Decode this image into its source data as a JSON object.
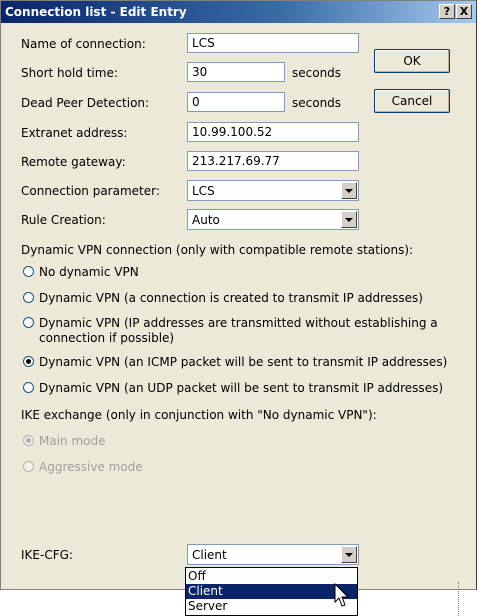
{
  "window": {
    "title": "Connection list - Edit Entry",
    "help_label": "?",
    "close_label": "X"
  },
  "buttons": {
    "ok": "OK",
    "cancel": "Cancel"
  },
  "fields": {
    "name": {
      "label": "Name of connection:",
      "value": "LCS"
    },
    "short_hold": {
      "label": "Short hold time:",
      "value": "30",
      "unit": "seconds"
    },
    "dpd": {
      "label": "Dead Peer Detection:",
      "value": "0",
      "unit": "seconds"
    },
    "extranet": {
      "label": "Extranet address:",
      "value": "10.99.100.52"
    },
    "gateway": {
      "label": "Remote gateway:",
      "value": "213.217.69.77"
    },
    "conn_param": {
      "label": "Connection parameter:",
      "value": "LCS"
    },
    "rule": {
      "label": "Rule Creation:",
      "value": "Auto"
    }
  },
  "dynamic_vpn": {
    "heading": "Dynamic VPN connection (only with compatible remote stations):",
    "options": [
      {
        "label": "No dynamic VPN",
        "selected": false
      },
      {
        "label": "Dynamic VPN (a connection is created to transmit IP addresses)",
        "selected": false
      },
      {
        "label": "Dynamic VPN (IP addresses are transmitted without establishing a",
        "label2": "connection if possible)",
        "selected": false
      },
      {
        "label": "Dynamic VPN (an ICMP packet will be sent to transmit IP addresses)",
        "selected": true
      },
      {
        "label": "Dynamic VPN (an UDP packet will be sent to transmit IP addresses)",
        "selected": false
      }
    ]
  },
  "ike": {
    "heading": "IKE exchange (only in conjunction with \"No dynamic VPN\"):",
    "options": [
      {
        "label": "Main mode",
        "selected": true,
        "disabled": true
      },
      {
        "label": "Aggressive mode",
        "selected": false,
        "disabled": true
      }
    ]
  },
  "ike_cfg": {
    "label": "IKE-CFG:",
    "value": "Client",
    "options": [
      "Off",
      "Client",
      "Server"
    ],
    "highlighted": "Client"
  }
}
